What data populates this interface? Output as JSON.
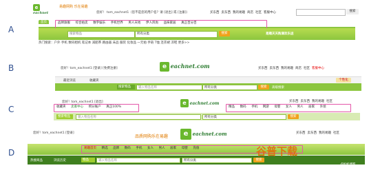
{
  "rows": [
    {
      "label": "A",
      "logo_text": "eachnet",
      "slogan": "易趣网购 乐在易趣",
      "greeting": "您好！ tom_eachnet1（您不是您的用户名？请 [退出] 或 [注册]）",
      "top_links": [
        "买东西",
        "卖东西",
        "我的易趣",
        "商店",
        "社区",
        "客服中心",
        "搜索"
      ],
      "tabs": [
        "首页",
        "品牌旗舰",
        "综合拍卖",
        "数字娱乐",
        "手机世界",
        "男人天地",
        "伊人风尚",
        "品味家居",
        "真正百分百"
      ],
      "search_placeholder": "搜索物品",
      "search_category": "所有分类",
      "search_btn": "搜索",
      "hot_label": "热门搜索：",
      "hot_keywords": "户外 手机 数码相机 笔记本 减肥茶 路由器 床品 服装 化妆品 一元拍 手链 T恤 连衣裙 凉鞋 更多>>",
      "promo": "易趣天天购满欢乐送"
    },
    {
      "label": "B",
      "logo_text": "eachnet.com",
      "greeting": "您好！tom_eachnet1 [登录] [免费注册]",
      "top_links": [
        "买东西",
        "卖东西",
        "我的易趣",
        "商店",
        "社区",
        "客服中心"
      ],
      "left_buttons": [
        "最近浏览",
        "收藏夹"
      ],
      "search_category": "搜索物品",
      "search_placeholder": "输入物品名称",
      "search_scope": "所有分类",
      "search_btn": "搜索",
      "search_btn2": "高级搜索",
      "right_btn": "个性化"
    },
    {
      "label": "C",
      "logo_text": "eachnet.com",
      "greeting": "您好！tom_eachnet1 [退出]",
      "left_links": [
        "收藏夹",
        "卖家中心",
        "积分账户",
        "真正100%"
      ],
      "top_links": [
        "买东西",
        "卖东西",
        "我的易趣",
        "社区"
      ],
      "nav_links": [
        "精品",
        "数码",
        "手机",
        "网游",
        "母婴",
        "女人",
        "男人",
        "居家",
        "外烩"
      ],
      "search_category": "搜索物品",
      "search_placeholder": "输入物品名称",
      "search_scope": "所有分类",
      "search_btn": "搜索"
    },
    {
      "label": "D",
      "logo_text": "eachnet.com",
      "slogan": "品质网购乐在易趣",
      "greeting": "您好！tom_eachnet1 [登录]",
      "top_links": [
        "买东西",
        "卖东西",
        "我的易趣",
        "社区"
      ],
      "nav_links": [
        "易趣首页",
        "精选",
        "品牌",
        "数码",
        "手机",
        "女人",
        "男人",
        "居家",
        "母婴",
        "充值"
      ],
      "left_buttons": [
        "热搜商品",
        "浏览历史"
      ],
      "search_category": "物品",
      "search_placeholder": "输入物品名称",
      "search_scope": "所有分类",
      "search_btn": "搜索",
      "watermark": "谷普下载",
      "watermark_small": "卢松松博客"
    }
  ]
}
